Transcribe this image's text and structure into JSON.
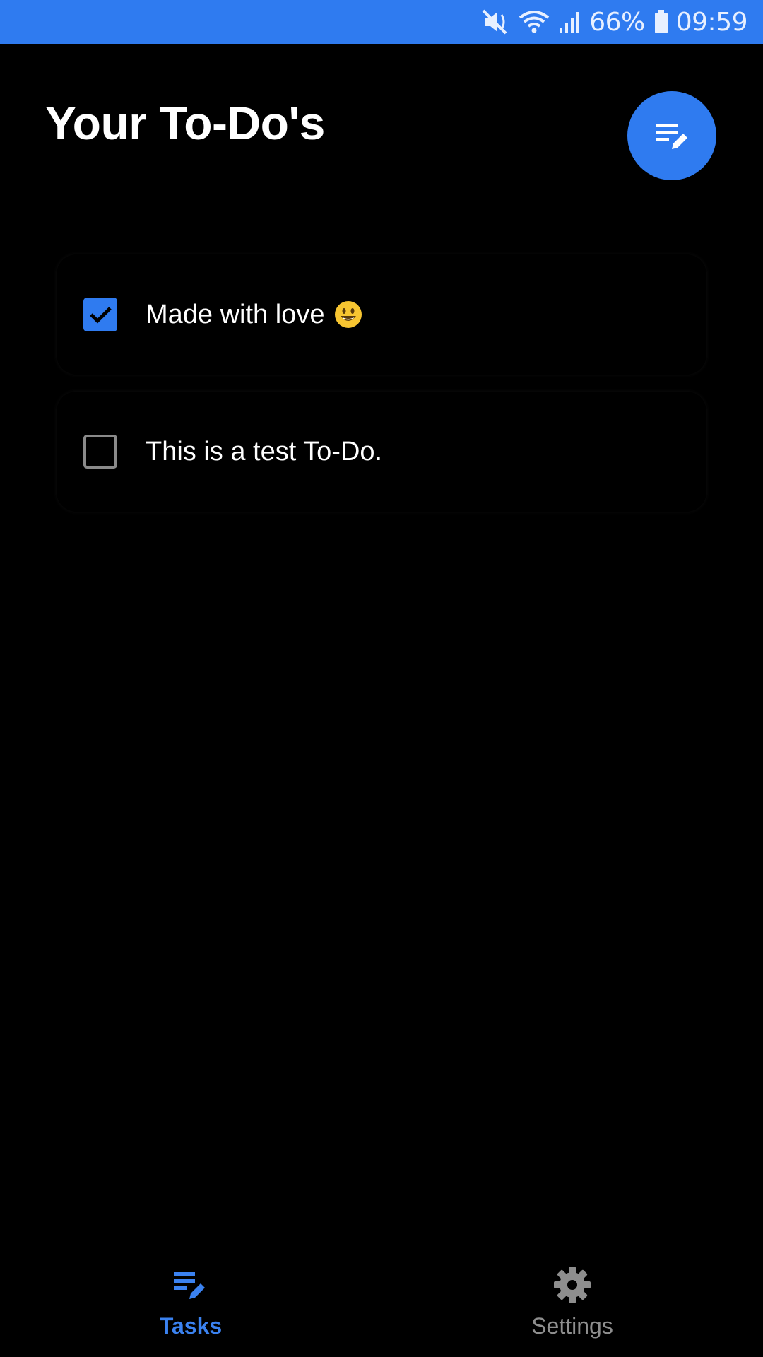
{
  "status_bar": {
    "battery": "66%",
    "time": "09:59",
    "icons": [
      "mute-icon",
      "wifi-icon",
      "signal-icon",
      "battery-icon"
    ]
  },
  "header": {
    "title": "Your To-Do's",
    "fab_icon": "edit-list-icon"
  },
  "tasks": [
    {
      "label": "Made with love",
      "emoji": "smiley-emoji",
      "checked": true
    },
    {
      "label": "This is a test To-Do.",
      "checked": false
    }
  ],
  "nav": {
    "items": [
      {
        "label": "Tasks",
        "icon": "edit-list-icon",
        "active": true
      },
      {
        "label": "Settings",
        "icon": "gear-icon",
        "active": false
      }
    ]
  },
  "colors": {
    "accent": "#2f7bf0",
    "background": "#000000",
    "inactive": "#8e8e8e"
  }
}
